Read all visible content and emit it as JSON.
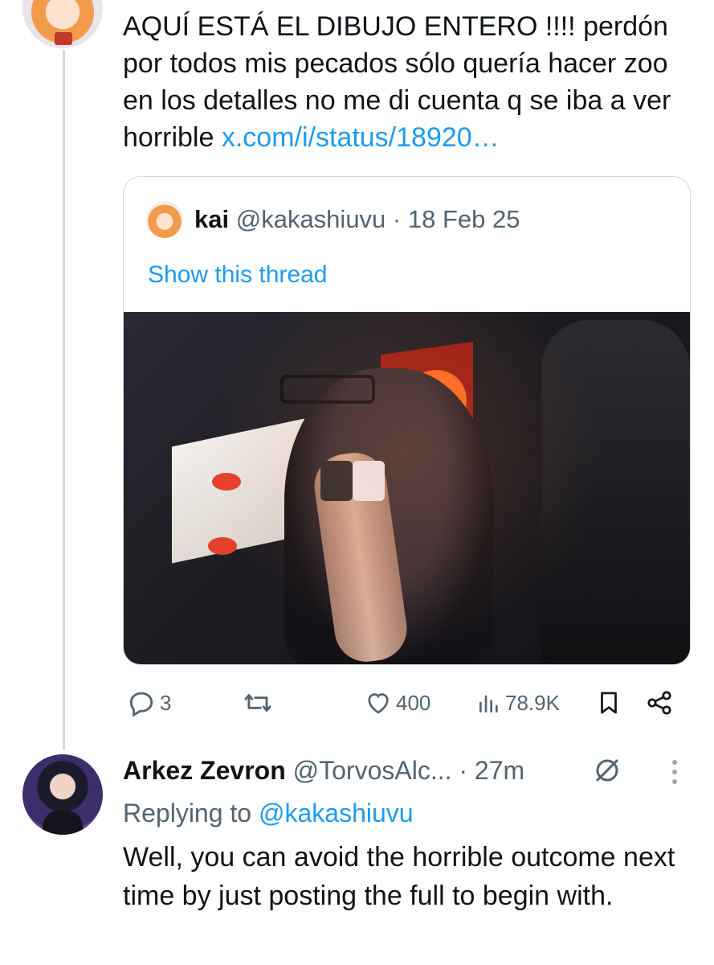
{
  "main_tweet": {
    "text": "AQUÍ ESTÁ EL DIBUJO ENTERO !!!! perdón por todos mis pecados sólo quería hacer zoo en los detalles no me di cuenta q se iba a ver horrible ",
    "link_text": "x.com/i/status/18920…"
  },
  "quote": {
    "name": "kai",
    "handle": "@kakashiuvu",
    "separator": " · ",
    "date": "18 Feb 25",
    "show_thread": "Show this thread"
  },
  "actions": {
    "replies": "3",
    "retweets": "",
    "likes": "400",
    "views": "78.9K",
    "icons": [
      "reply-icon",
      "retweet-icon",
      "like-icon",
      "views-icon",
      "bookmark-icon",
      "share-icon"
    ]
  },
  "reply": {
    "name": "Arkez Zevron",
    "handle": "@TorvosAlc...",
    "separator": " · ",
    "time": "27m",
    "replying_prefix": "Replying to ",
    "replying_to": "@kakashiuvu",
    "text": "Well, you can avoid the horrible outcome next time by just posting the full to begin with."
  },
  "colors": {
    "link": "#1d9bf0",
    "muted": "#536471",
    "text": "#0f1419",
    "border": "#cfd9de"
  }
}
